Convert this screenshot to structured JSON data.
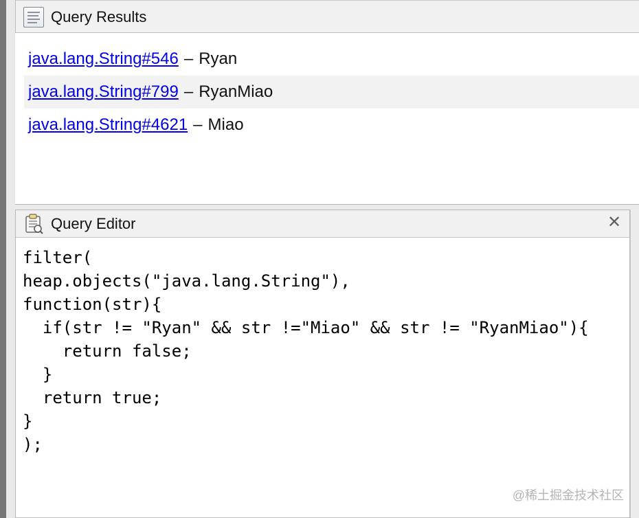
{
  "results_panel": {
    "title": "Query Results",
    "icon": "results-table-icon",
    "rows": [
      {
        "link": "java.lang.String#546",
        "separator": "–",
        "value": "Ryan"
      },
      {
        "link": "java.lang.String#799",
        "separator": "–",
        "value": "RyanMiao"
      },
      {
        "link": "java.lang.String#4621",
        "separator": "–",
        "value": "Miao"
      }
    ]
  },
  "editor_panel": {
    "title": "Query Editor",
    "icon": "query-editor-icon",
    "close_label": "✕",
    "code": "filter(\nheap.objects(\"java.lang.String\"),\nfunction(str){\n  if(str != \"Ryan\" && str !=\"Miao\" && str != \"RyanMiao\"){\n    return false;\n  }\n  return true;\n}\n);"
  },
  "watermark": "@稀土掘金技术社区",
  "colors": {
    "link": "#0000ee",
    "header_bg": "#f1f1f1",
    "alt_row_bg": "#f2f2f2"
  }
}
